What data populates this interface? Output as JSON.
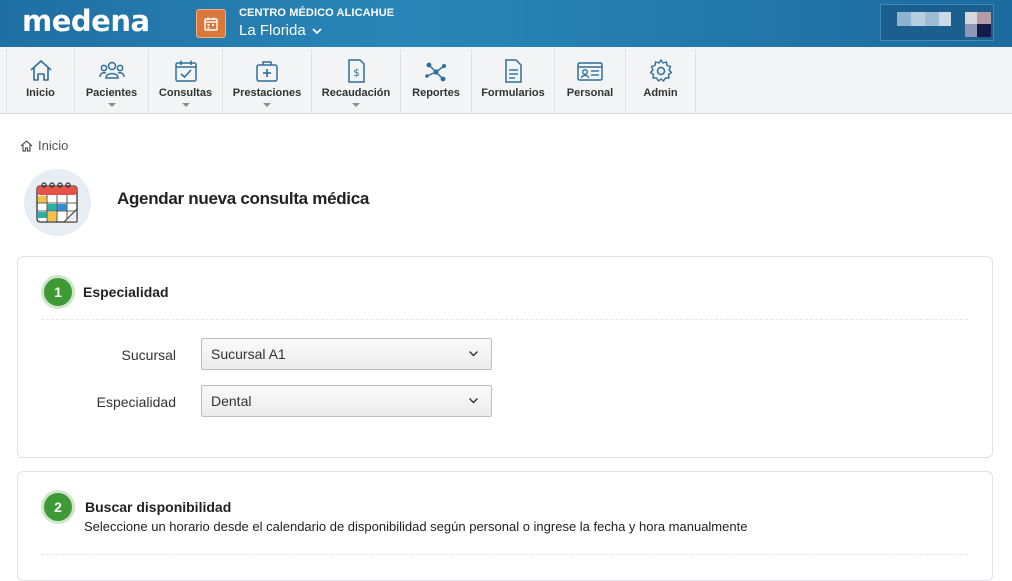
{
  "header": {
    "logo": "medena",
    "center_name": "CENTRO MÉDICO ALICAHUE",
    "branch": "La Florida",
    "accent": "#1f6fa3",
    "center_icon_color": "#d9783a"
  },
  "nav": {
    "items": [
      {
        "label": "Inicio",
        "icon": "home-icon",
        "has_dropdown": false
      },
      {
        "label": "Pacientes",
        "icon": "users-icon",
        "has_dropdown": true
      },
      {
        "label": "Consultas",
        "icon": "calendar-check-icon",
        "has_dropdown": true
      },
      {
        "label": "Prestaciones",
        "icon": "medical-kit-icon",
        "has_dropdown": true
      },
      {
        "label": "Recaudación",
        "icon": "invoice-icon",
        "has_dropdown": true
      },
      {
        "label": "Reportes",
        "icon": "network-icon",
        "has_dropdown": false
      },
      {
        "label": "Formularios",
        "icon": "document-icon",
        "has_dropdown": false
      },
      {
        "label": "Personal",
        "icon": "id-card-icon",
        "has_dropdown": false
      },
      {
        "label": "Admin",
        "icon": "gear-icon",
        "has_dropdown": false
      }
    ]
  },
  "breadcrumb": {
    "home": "Inicio"
  },
  "page": {
    "title": "Agendar nueva consulta médica"
  },
  "step1": {
    "number": "1",
    "title": "Especialidad",
    "sucursal_label": "Sucursal",
    "sucursal_value": "Sucursal A1",
    "especialidad_label": "Especialidad",
    "especialidad_value": "Dental"
  },
  "step2": {
    "number": "2",
    "title": "Buscar disponibilidad",
    "subtitle": "Seleccione un horario desde el calendario de disponibilidad según personal o ingrese la fecha y hora manualmente"
  }
}
